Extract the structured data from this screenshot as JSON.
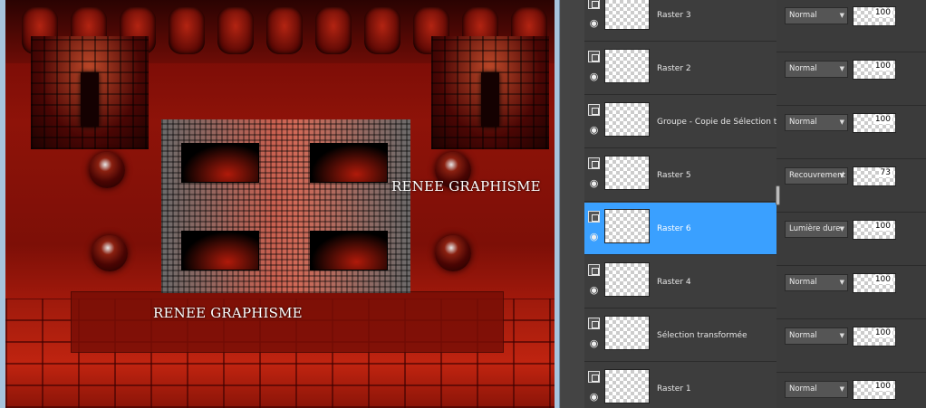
{
  "canvas": {
    "watermark_top": "RENEE GRAPHISME",
    "watermark_bottom": "RENEE GRAPHISME"
  },
  "layers": [
    {
      "name": "Raster 3",
      "mode": "Normal",
      "opacity": "100",
      "selected": false
    },
    {
      "name": "Raster 2",
      "mode": "Normal",
      "opacity": "100",
      "selected": false
    },
    {
      "name": "Groupe - Copie de Sélection transf",
      "mode": "Normal",
      "opacity": "100",
      "selected": false
    },
    {
      "name": "Raster 5",
      "mode": "Recouvrement",
      "opacity": "73",
      "selected": false
    },
    {
      "name": "Raster 6",
      "mode": "Lumière dure",
      "opacity": "100",
      "selected": true
    },
    {
      "name": "Raster 4",
      "mode": "Normal",
      "opacity": "100",
      "selected": false
    },
    {
      "name": "Sélection transformée",
      "mode": "Normal",
      "opacity": "100",
      "selected": false
    },
    {
      "name": "Raster 1",
      "mode": "Normal",
      "opacity": "100",
      "selected": false
    }
  ],
  "icons": {
    "link": "layer-link-icon",
    "visibility": "eye-icon",
    "dropdown": "chevron-down-icon"
  },
  "colors": {
    "selection": "#3aa0ff",
    "panel_bg": "#3d3d3d",
    "canvas_red": "#8e1309"
  }
}
